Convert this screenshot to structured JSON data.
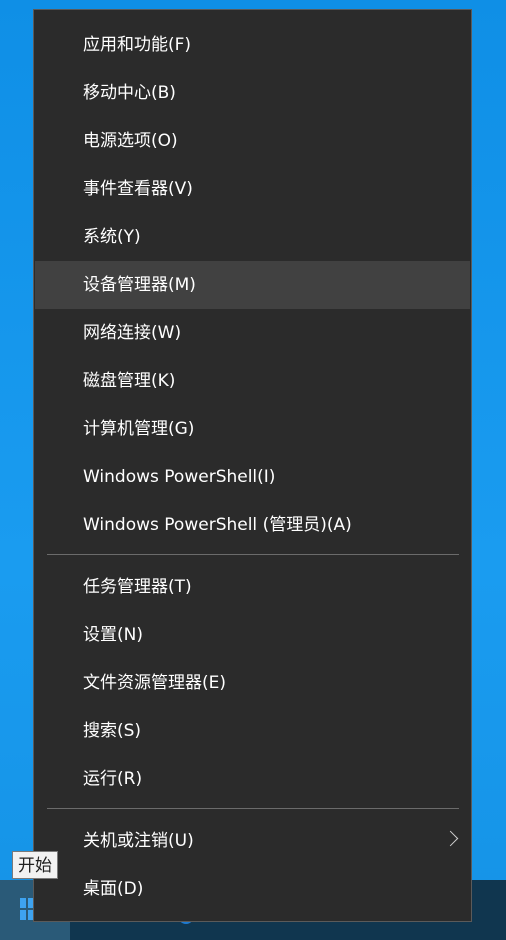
{
  "menu": {
    "items": [
      {
        "label": "应用和功能(F)"
      },
      {
        "label": "移动中心(B)"
      },
      {
        "label": "电源选项(O)"
      },
      {
        "label": "事件查看器(V)"
      },
      {
        "label": "系统(Y)"
      },
      {
        "label": "设备管理器(M)"
      },
      {
        "label": "网络连接(W)"
      },
      {
        "label": "磁盘管理(K)"
      },
      {
        "label": "计算机管理(G)"
      },
      {
        "label": "Windows PowerShell(I)"
      },
      {
        "label": "Windows PowerShell (管理员)(A)"
      },
      {
        "label": "任务管理器(T)"
      },
      {
        "label": "设置(N)"
      },
      {
        "label": "文件资源管理器(E)"
      },
      {
        "label": "搜索(S)"
      },
      {
        "label": "运行(R)"
      },
      {
        "label": "关机或注销(U)"
      },
      {
        "label": "桌面(D)"
      }
    ],
    "highlighted_item": "设备管理器(M)",
    "submenu_item": "关机或注销(U)"
  },
  "tooltip": {
    "text": "开始"
  },
  "colors": {
    "menu_bg": "#2b2b2b",
    "hover_bg": "#414141",
    "text": "#ffffff",
    "desktop": "#1493e8",
    "taskbar": "#10364f"
  }
}
